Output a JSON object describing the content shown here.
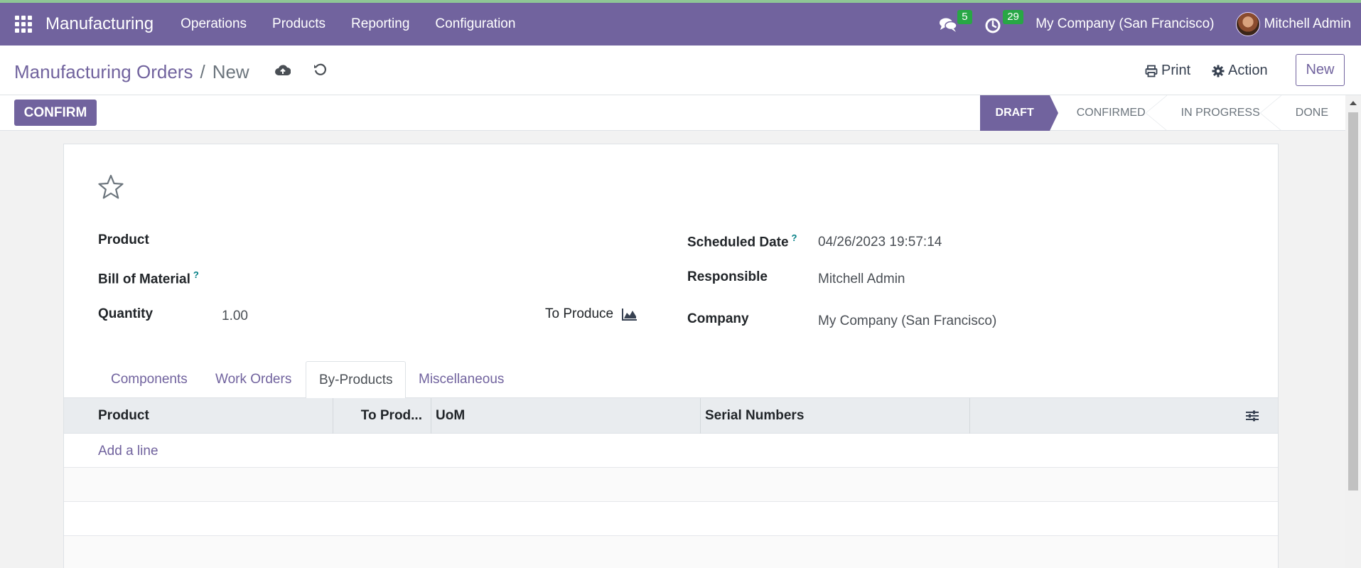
{
  "navbar": {
    "brand": "Manufacturing",
    "menu": [
      "Operations",
      "Products",
      "Reporting",
      "Configuration"
    ],
    "messages_count": "5",
    "activities_count": "29",
    "company": "My Company (San Francisco)",
    "user": "Mitchell Admin"
  },
  "control_panel": {
    "breadcrumb_parent": "Manufacturing Orders",
    "breadcrumb_separator": "/",
    "breadcrumb_current": "New",
    "print_label": "Print",
    "action_label": "Action",
    "new_label": "New"
  },
  "statusbar": {
    "confirm_label": "CONFIRM",
    "stages": [
      "DRAFT",
      "CONFIRMED",
      "IN PROGRESS",
      "DONE"
    ],
    "active_stage": "DRAFT"
  },
  "form": {
    "product_label": "Product",
    "bom_label": "Bill of Material",
    "help_mark": "?",
    "quantity_label": "Quantity",
    "quantity_value": "1.00",
    "to_produce_label": "To Produce",
    "scheduled_date_label": "Scheduled Date",
    "scheduled_date_value": "04/26/2023 19:57:14",
    "responsible_label": "Responsible",
    "responsible_value": "Mitchell Admin",
    "company_label": "Company",
    "company_value": "My Company (San Francisco)"
  },
  "tabs": [
    "Components",
    "Work Orders",
    "By-Products",
    "Miscellaneous"
  ],
  "active_tab": "By-Products",
  "table": {
    "columns": [
      "Product",
      "To Prod...",
      "UoM",
      "Serial Numbers"
    ],
    "add_line": "Add a line"
  },
  "colors": {
    "brand": "#71639e",
    "badge": "#28a745",
    "help": "#017e84"
  }
}
